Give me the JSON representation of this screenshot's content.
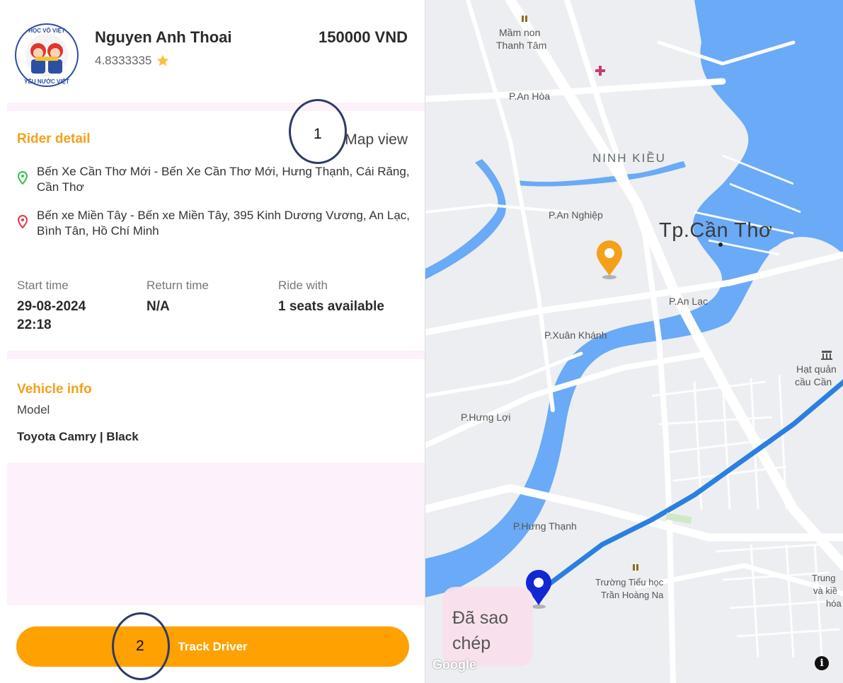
{
  "driver": {
    "name": "Nguyen Anh Thoai",
    "rating": "4.8333335",
    "price": "150000 VND",
    "logo_text": [
      "HỌC VÕ VIỆT",
      "YÊU NƯỚC VIỆT"
    ]
  },
  "rider_detail": {
    "title": "Rider detail",
    "map_view_label": "Map view",
    "pickup": "Bến Xe Cần Thơ Mới - Bến Xe Cần Thơ Mới, Hưng Thạnh, Cái Răng, Cần Thơ",
    "dropoff": "Bến xe Miền Tây - Bến xe Miền Tây, 395 Kinh Dương Vương, An Lạc, Bình Tân, Hồ Chí Minh"
  },
  "trip": {
    "start_label": "Start time",
    "start_date": "29-08-2024",
    "start_time": "22:18",
    "return_label": "Return time",
    "return_value": "N/A",
    "ride_label": "Ride with",
    "ride_value": "1 seats available"
  },
  "vehicle": {
    "title": "Vehicle info",
    "model_label": "Model",
    "model_value": "Toyota Camry | Black"
  },
  "actions": {
    "track_driver": "Track Driver"
  },
  "annotations": {
    "first": "1",
    "second": "2"
  },
  "map": {
    "labels": {
      "mam_non_1": "Mầm non",
      "mam_non_2": "Thanh Tâm",
      "an_hoa": "P.An Hòa",
      "ninh_kieu": "NINH KIỀU",
      "an_nghiep": "P.An Nghiệp",
      "city": "Tp.Cần Thơ",
      "an_lac": "P.An Lạc",
      "xuan_khanh": "P.Xuân Khánh",
      "hat_quan_1": "Hạt quản",
      "hat_quan_2": "cầu Cần",
      "hung_loi": "P.Hưng Lợi",
      "hung_thanh": "P.Hưng Thạnh",
      "school_1": "Trường Tiểu học",
      "school_2": "Trần Hoàng Na",
      "trung_1": "Trung",
      "trung_2": "và kiề",
      "trung_3": "hóa"
    },
    "copied_toast": [
      "Đã sao",
      "chép"
    ],
    "attribution": "Google"
  },
  "colors": {
    "accent": "#ffa100",
    "section_title": "#f5a019",
    "route": "#2b7fe0",
    "river": "#6aaaf6",
    "band": "#fdf1fb"
  },
  "icons": {
    "rating": "star-icon",
    "pickup": "pickup-pin-icon",
    "dropoff": "dropoff-pin-icon",
    "origin_marker": "orange-map-pin-icon",
    "driver_marker": "blue-map-pin-icon",
    "info": "info-icon"
  }
}
